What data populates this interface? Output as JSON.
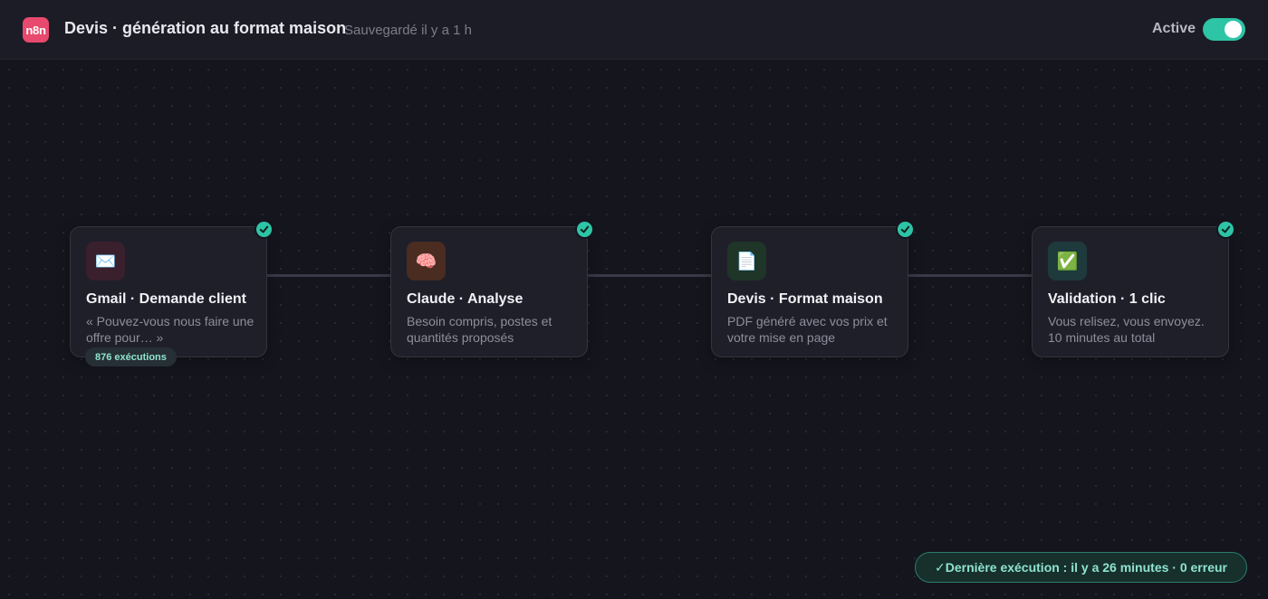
{
  "header": {
    "logo_text": "n8n",
    "title": "Devis · génération au format maison",
    "saved_status": "Sauvegardé il y a 1 h",
    "active_label": "Active",
    "active": true
  },
  "nodes": [
    {
      "icon": "envelope-icon",
      "icon_glyph": "✉️",
      "title": "Gmail · Demande client",
      "desc": "« Pouvez-vous nous faire une offre pour… »",
      "status": "success",
      "icon_bg": "#3a1f2c"
    },
    {
      "icon": "brain-icon",
      "icon_glyph": "🧠",
      "title": "Claude · Analyse",
      "desc": "Besoin compris, postes et quantités proposés",
      "status": "success",
      "icon_bg": "#4a2c20"
    },
    {
      "icon": "document-icon",
      "icon_glyph": "📄",
      "title": "Devis · Format maison",
      "desc": "PDF généré avec vos prix et votre mise en page",
      "status": "success",
      "icon_bg": "#1e3527"
    },
    {
      "icon": "checkmark-icon",
      "icon_glyph": "✅",
      "title": "Validation · 1 clic",
      "desc": "Vous relisez, vous envoyez. 10 minutes au total",
      "status": "success",
      "icon_bg": "#1e3a3c"
    }
  ],
  "execution_badge": "876 exécutions",
  "footer_status": "✓Dernière exécution : il y a 26 minutes · 0 erreur",
  "colors": {
    "accent": "#2ec4a6",
    "brand": "#e8496e",
    "background": "#15151e"
  }
}
